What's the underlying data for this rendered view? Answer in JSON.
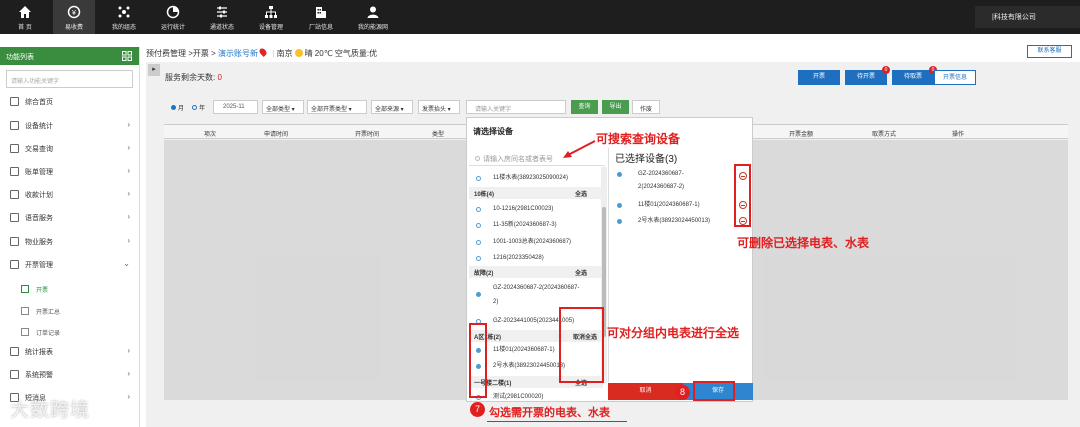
{
  "nav": {
    "items": [
      {
        "label": "首 页",
        "icon": "home-icon"
      },
      {
        "label": "易收费",
        "icon": "money-icon"
      },
      {
        "label": "我的组态",
        "icon": "cluster-icon"
      },
      {
        "label": "运行统计",
        "icon": "pie-icon"
      },
      {
        "label": "通道状态",
        "icon": "sliders-icon"
      },
      {
        "label": "设备管理",
        "icon": "org-icon"
      },
      {
        "label": "厂站信息",
        "icon": "building-icon"
      },
      {
        "label": "我的能源网",
        "icon": "user-icon"
      }
    ],
    "company": "|科技有限公司"
  },
  "sidebar": {
    "title": "功能列表",
    "search_placeholder": "请输入功能关键字",
    "items": [
      {
        "label": "综合首页"
      },
      {
        "label": "设备统计"
      },
      {
        "label": "交易查询"
      },
      {
        "label": "账单管理"
      },
      {
        "label": "收款计划"
      },
      {
        "label": "语音服务"
      },
      {
        "label": "物业服务"
      },
      {
        "label": "开票管理"
      },
      {
        "label": "统计报表"
      },
      {
        "label": "系统预警"
      },
      {
        "label": "短消息"
      }
    ],
    "subitems": [
      {
        "label": "开票"
      },
      {
        "label": "开票汇总"
      },
      {
        "label": "订单记录"
      }
    ]
  },
  "breadcrumb": {
    "path": "预付费管理 >开票 >",
    "link": "演示账号新",
    "city": "南京",
    "weather": "晴 20℃ 空气质量:优"
  },
  "contact_button": "联系客服",
  "remaining": {
    "label": "服务剩余天数:",
    "value": "0"
  },
  "actions": [
    {
      "label": "开票",
      "badge": ""
    },
    {
      "label": "待开票",
      "badge": "0"
    },
    {
      "label": "待取票",
      "badge": "0"
    },
    {
      "label": "开票信息",
      "badge": ""
    }
  ],
  "filters": {
    "radio_month": "月",
    "radio_year": "年",
    "date": "2025-11",
    "type_all": "全部类型",
    "invoice_type_all": "全部开票类型",
    "source_all": "全部来源",
    "invoice_header": "发票抬头",
    "keyword_placeholder": "请输入关键字",
    "query": "查询",
    "export": "导出",
    "void": "作废"
  },
  "table": {
    "headers": [
      "项次",
      "申请时间",
      "开票时间",
      "类型",
      "开票金额",
      "取票方式",
      "操作"
    ]
  },
  "modal": {
    "title": "请选择设备",
    "search_placeholder": "请输入房间名或者表号",
    "left_list": [
      {
        "kind": "row",
        "label": "11楼水表(38923025090024)",
        "checked": false
      },
      {
        "kind": "group",
        "label": "10栋(4)",
        "action": "全选"
      },
      {
        "kind": "row",
        "label": "10-1216(2981C00023)",
        "checked": false
      },
      {
        "kind": "row",
        "label": "11-35新(2024360687-3)",
        "checked": false
      },
      {
        "kind": "row",
        "label": "1001-1003总表(2024360687)",
        "checked": false
      },
      {
        "kind": "row",
        "label": "1216(2023350428)",
        "checked": false
      },
      {
        "kind": "group",
        "label": "故障(2)",
        "action": "全选"
      },
      {
        "kind": "row2",
        "label": "GZ-2024360687-2(2024360687-",
        "label2": "2)",
        "checked": true
      },
      {
        "kind": "row",
        "label": "GZ-2023441005(2023441005)",
        "checked": false
      },
      {
        "kind": "group",
        "label": "A区1栋(2)",
        "action": "取消全选"
      },
      {
        "kind": "row",
        "label": "11楼01(2024360687-1)",
        "checked": true
      },
      {
        "kind": "row",
        "label": "2号水表(38923024450013)",
        "checked": true
      },
      {
        "kind": "group",
        "label": "一号楼二楼(1)",
        "action": "全选"
      },
      {
        "kind": "row",
        "label": "测试(2981C00020)",
        "checked": false
      }
    ],
    "selected_title": "已选择设备(3)",
    "selected": [
      {
        "label": "GZ-2024360687-",
        "label2": "2(2024360687-2)"
      },
      {
        "label": "11楼01(2024360687-1)",
        "label2": ""
      },
      {
        "label": "2号水表(38923024450013)",
        "label2": ""
      }
    ],
    "cancel": "取消",
    "save": "保存"
  },
  "annotations": {
    "search": "可搜索查询设备",
    "delete": "可删除已选择电表、水表",
    "select_all": "可对分组内电表进行全选",
    "step7_num": "7",
    "step7": "勾选需开票的电表、水表",
    "step8_num": "8"
  },
  "watermark": "大数跨境"
}
